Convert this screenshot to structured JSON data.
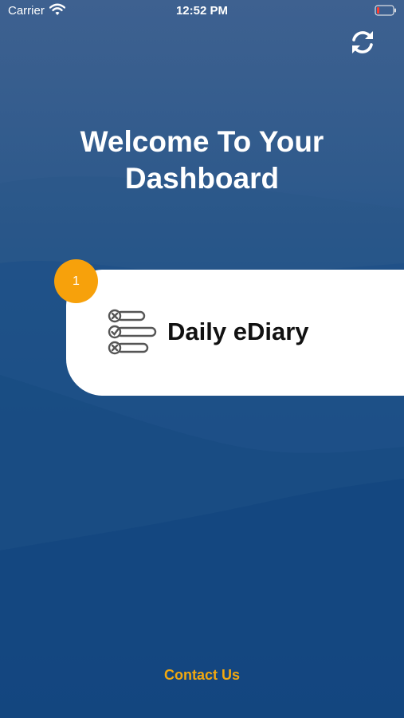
{
  "status_bar": {
    "carrier": "Carrier",
    "time": "12:52 PM",
    "icons": [
      "wifi-icon",
      "battery-icon"
    ]
  },
  "header": {
    "refresh_icon": "refresh-icon"
  },
  "main": {
    "title_line1": "Welcome To Your",
    "title_line2": "Dashboard",
    "card": {
      "label": "Daily eDiary",
      "badge": "1",
      "icon": "checklist-icon"
    }
  },
  "footer": {
    "contact_label": "Contact Us"
  },
  "colors": {
    "background": "#1d5289",
    "badge": "#f7a10b",
    "contact": "#f2a80f",
    "card": "#ffffff"
  }
}
